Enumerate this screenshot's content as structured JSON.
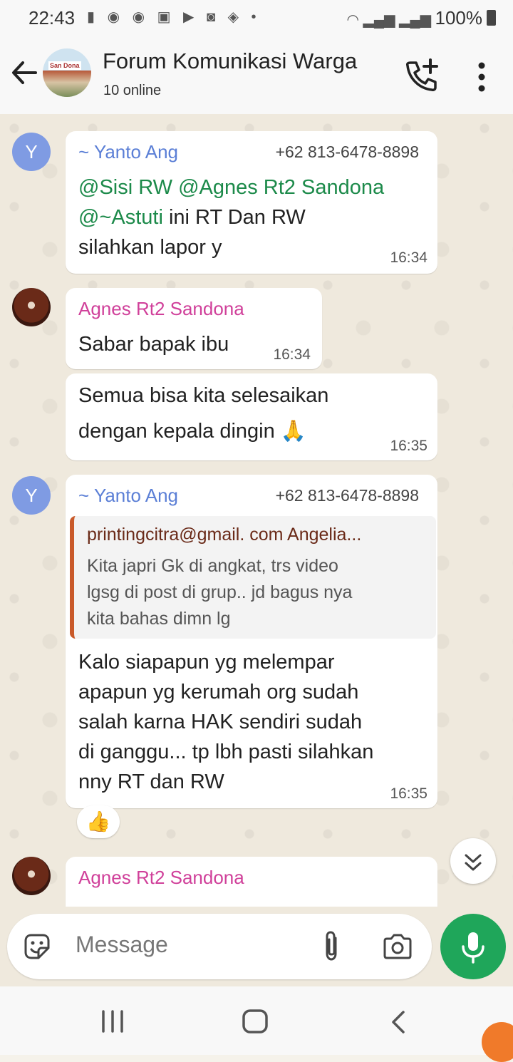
{
  "status": {
    "time": "22:43",
    "icons": [
      "message-icon",
      "app-icon",
      "app-icon",
      "gift-icon",
      "youtube-icon",
      "app-icon",
      "shield-icon",
      "dot-icon"
    ],
    "battery": "100%"
  },
  "header": {
    "title": "Forum Komunikasi Warga",
    "subtitle": "10 online",
    "avatar_text": "San Dona"
  },
  "messages": {
    "m1": {
      "sender": "~ Yanto Ang",
      "phone": "+62 813-6478-8898",
      "mention1": "@Sisi RW @Agnes Rt2 Sandona",
      "mention2": "@~Astuti",
      "rest": " ini RT Dan RW",
      "line3": "silahkan lapor y",
      "time": "16:34",
      "avatar": "Y"
    },
    "m2": {
      "sender": "Agnes Rt2 Sandona",
      "text": "Sabar bapak ibu",
      "time": "16:34"
    },
    "m3": {
      "line1": "Semua bisa kita selesaikan",
      "line2": "dengan kepala dingin 🙏",
      "time": "16:35"
    },
    "m4": {
      "sender": "~ Yanto Ang",
      "phone": "+62 813-6478-8898",
      "avatar": "Y",
      "quote_sender": "printingcitra@gmail. com Angelia...",
      "quote_lines": [
        "Kita japri Gk di angkat, trs video",
        "lgsg di post di grup.. jd bagus nya",
        "kita bahas dimn lg"
      ],
      "lines": [
        "Kalo siapapun yg melempar",
        "apapun yg kerumah org sudah",
        "salah karna HAK sendiri sudah",
        "di ganggu... tp lbh pasti silahkan",
        "nny RT dan RW"
      ],
      "time": "16:35",
      "reaction": "👍"
    },
    "m5": {
      "sender": "Agnes Rt2 Sandona"
    }
  },
  "composer": {
    "placeholder": "Message"
  },
  "colors": {
    "accent": "#1fa65a",
    "mention": "#1c8a4a",
    "sender_pink": "#d0409a",
    "sender_blue": "#5b7fd6"
  }
}
